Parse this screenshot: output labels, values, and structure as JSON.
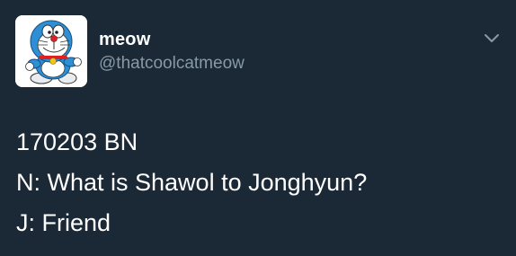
{
  "tweet": {
    "author": {
      "display_name": "meow",
      "handle": "@thatcoolcatmeow",
      "avatar_icon": "doraemon-avatar-icon"
    },
    "menu_icon": "chevron-down-icon",
    "lines": [
      "170203 BN",
      "N: What is Shawol to Jonghyun?",
      "J: Friend"
    ]
  },
  "colors": {
    "background": "#1b2836",
    "text": "#ffffff",
    "muted": "#8899a6"
  }
}
